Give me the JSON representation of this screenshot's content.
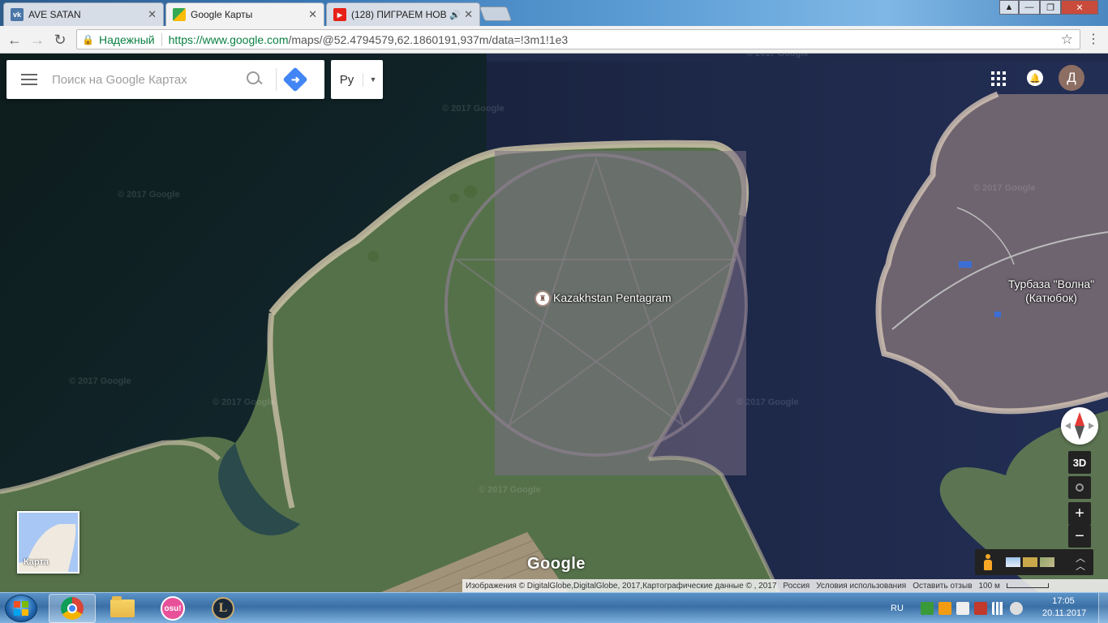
{
  "browser": {
    "tabs": [
      {
        "title": "AVE SATAN",
        "favicon": "vk-icon",
        "active": false
      },
      {
        "title": "Google Карты",
        "favicon": "google-maps-icon",
        "active": true
      },
      {
        "title": "(128) ПИГРАЕМ НОВ",
        "favicon": "youtube-icon",
        "active": false,
        "audio": true
      }
    ],
    "tab_close_glyph": "✕",
    "window_controls": {
      "minimize": "—",
      "maximize": "❐",
      "close": "✕"
    },
    "secure_label": "Надежный",
    "url_host": "https://www.google.com",
    "url_path": "/maps/@52.4794579,62.1860191,937m/data=!3m1!1e3"
  },
  "maps": {
    "search_placeholder": "Поиск на Google Картах",
    "language_value": "Ру",
    "avatar_letter": "Д",
    "place_label": "Kazakhstan Pentagram",
    "poi_label_line1": "Турбаза \"Волна\"",
    "poi_label_line2": "(Катюбок)",
    "watermark": "© 2017 Google",
    "button_3d": "3D",
    "zoom_in": "+",
    "zoom_out": "−",
    "layer_label": "Карта",
    "logo": "Google",
    "footer": {
      "imagery": "Изображения © DigitalGlobe,DigitalGlobe, 2017,Картографические данные © , 2017",
      "country": "Россия",
      "terms": "Условия использования",
      "feedback": "Оставить отзыв",
      "scale": "100 м"
    }
  },
  "taskbar": {
    "language": "RU",
    "time": "17:05",
    "date": "20.11.2017",
    "osu_label": "osu!",
    "lol_label": "L"
  },
  "colors": {
    "water": "#13213c",
    "land_green": "#55714a",
    "land_purple": "#6c6472",
    "shore": "#c9bfa8",
    "accent_blue": "#4285f4",
    "secure_green": "#0b8043"
  }
}
